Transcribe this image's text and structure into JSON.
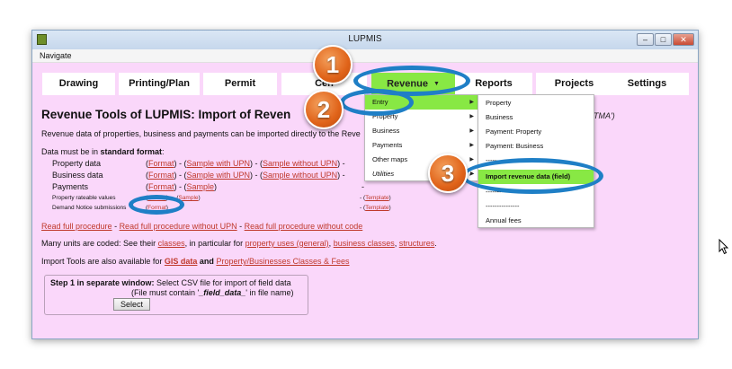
{
  "window": {
    "title": "LUPMIS",
    "buttons": {
      "min": "–",
      "max": "□",
      "close": "✕"
    }
  },
  "menubar": {
    "navigate": "Navigate"
  },
  "nav": {
    "drawing": "Drawing",
    "printing": "Printing/Plan",
    "permit": "Permit",
    "census": "Cen",
    "revenue": "Revenue",
    "reports": "Reports",
    "projects": "Projects",
    "settings": "Settings"
  },
  "page": {
    "title": "Revenue Tools of LUPMIS: Import of Reven",
    "stma": "STMA')",
    "intro": "Revenue data of properties, business and payments can be imported directly to the Reve",
    "format_prefix": "Data must be in ",
    "format_bold": "standard format",
    "format_suffix": ":",
    "rows": [
      {
        "label": "Property data",
        "format": "Format",
        "upn": "Sample with UPN",
        "noupn": "Sample without UPN",
        "tail": "-"
      },
      {
        "label": "Business data",
        "format": "Format",
        "upn": "Sample with UPN",
        "noupn": "Sample without UPN",
        "tail": "-"
      },
      {
        "label": "Payments",
        "format": "Format",
        "sample": "Sample",
        "tail": "-"
      }
    ],
    "small_rows": [
      {
        "label": "Property rateable values",
        "format": "Format",
        "sample": "Sample",
        "template": "Template"
      },
      {
        "label": "Demand Notice submissions",
        "format": "Format",
        "template": "Template"
      }
    ],
    "read_full": "Read full procedure",
    "read_noupn": "Read full procedure without UPN",
    "read_nocode": "Read full procedure without code",
    "coded_prefix": "Many units are coded: See their ",
    "coded_classes": "classes",
    "coded_mid": ", in particular for ",
    "coded_uses": "property uses (general)",
    "coded_business": "business classes",
    "coded_structures": "structures",
    "import_prefix": "Import Tools are also available for ",
    "import_gis": "GIS data",
    "import_and": " and ",
    "import_fees": "Property/Businesses Classes & Fees",
    "step_bold": "Step 1 in separate window:",
    "step_rest": " Select CSV file for import of field data",
    "step_line2_pre": "(File must contain '",
    "step_line2_bold": "_field_data_",
    "step_line2_post": "' in file name)",
    "select_label": "Select"
  },
  "revenue_menu": {
    "items": [
      "Entry",
      "Property",
      "Business",
      "Payments",
      "Other maps",
      "Utilities"
    ]
  },
  "entry_menu": {
    "items": [
      "Property",
      "Business",
      "Payment: Property",
      "Payment: Business",
      "---------------",
      "Import revenue data (field)",
      "---------------",
      "---------------",
      "Annual fees"
    ]
  },
  "callouts": [
    "1",
    "2",
    "3"
  ],
  "colors": {
    "background": "#fad7fa",
    "highlight": "#88e844",
    "link": "#c0392b",
    "ring": "#1f7fc6",
    "badge": "#e06319"
  }
}
